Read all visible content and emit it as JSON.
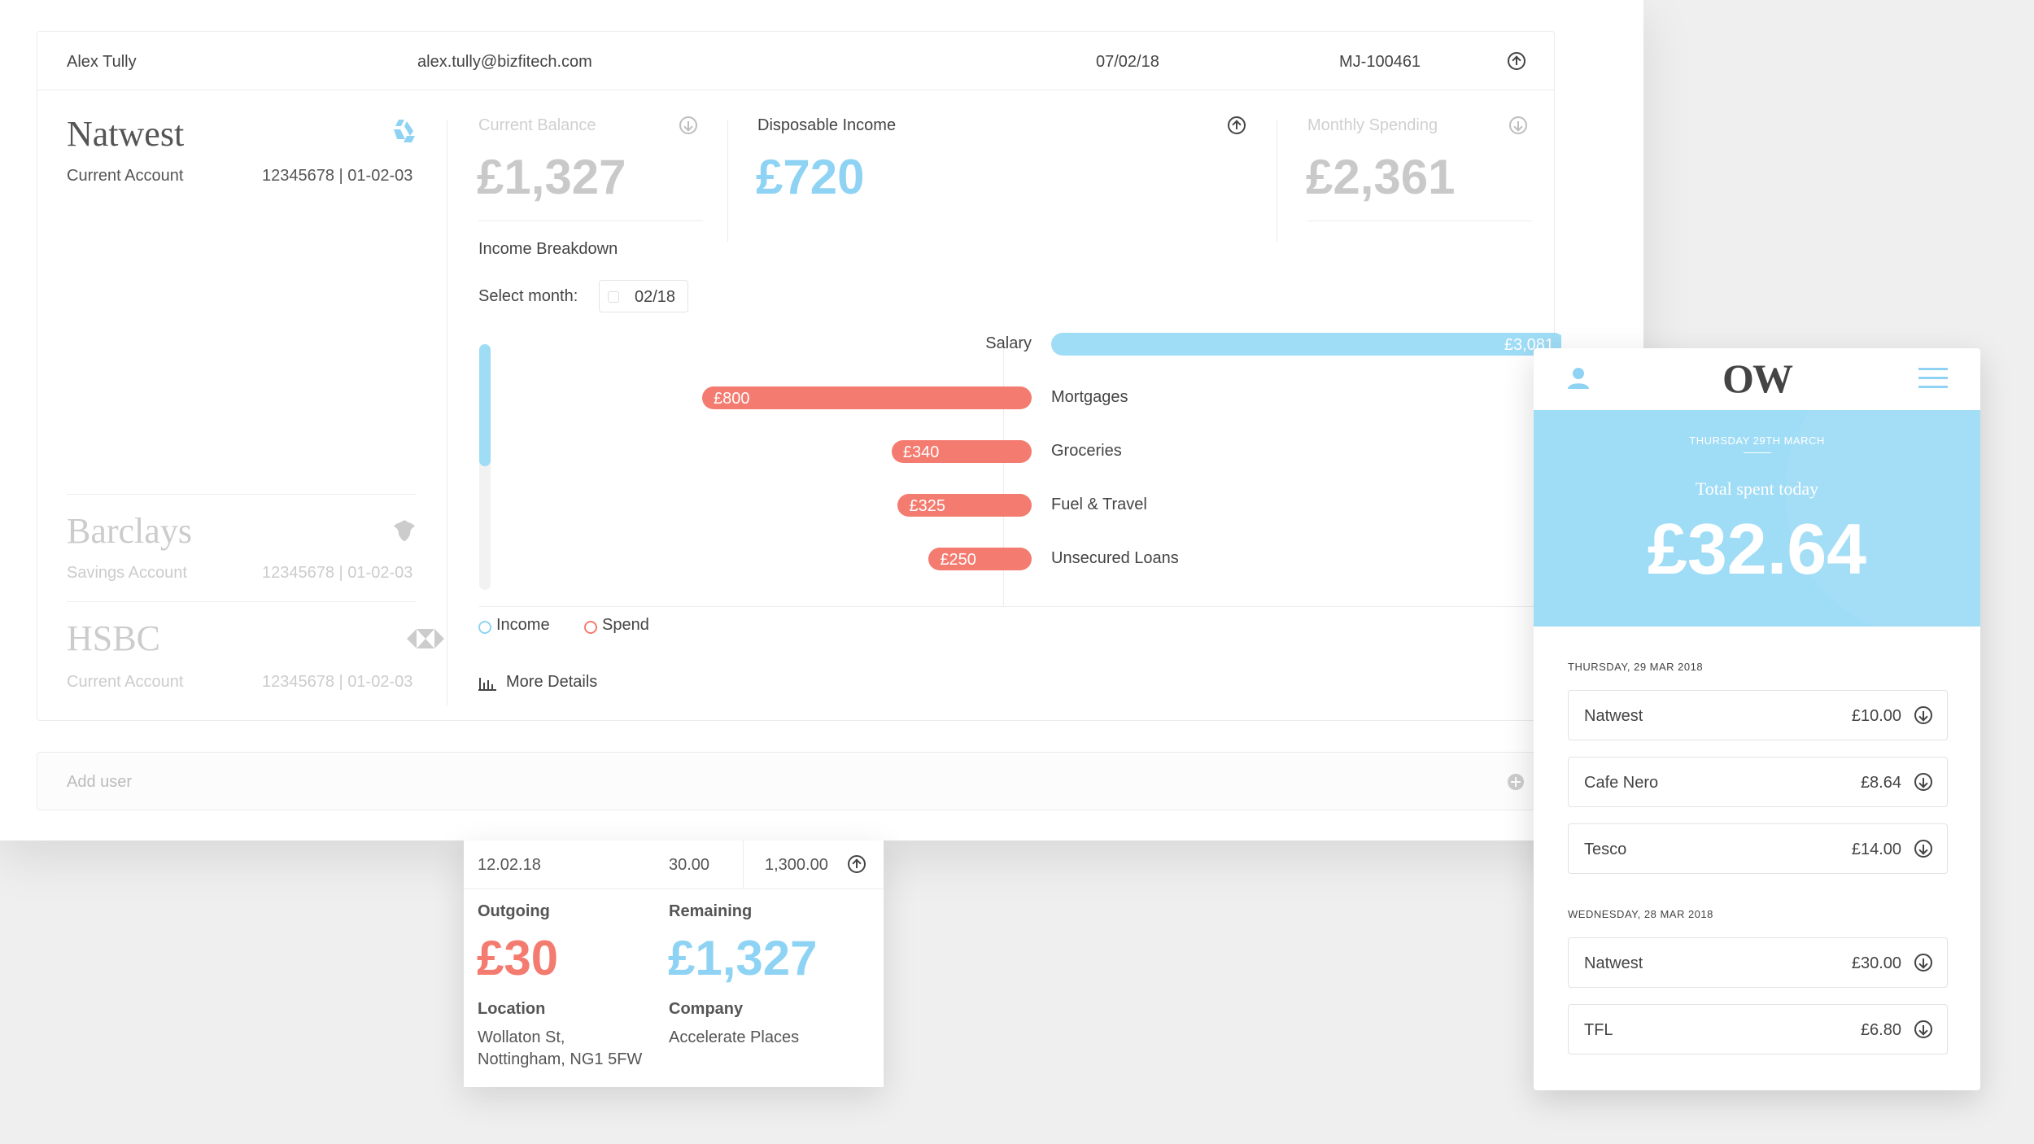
{
  "header": {
    "name": "Alex Tully",
    "email": "alex.tully@bizfitech.com",
    "date": "07/02/18",
    "reference": "MJ-100461"
  },
  "banks": [
    {
      "name": "Natwest",
      "type": "Current Account",
      "account": "12345678 | 01-02-03"
    },
    {
      "name": "Barclays",
      "type": "Savings Account",
      "account": "12345678 | 01-02-03"
    },
    {
      "name": "HSBC",
      "type": "Current Account",
      "account": "12345678 | 01-02-03"
    }
  ],
  "kpis": {
    "current_balance": {
      "label": "Current Balance",
      "value": "£1,327"
    },
    "disposable_income": {
      "label": "Disposable Income",
      "value": "£720"
    },
    "monthly_spending": {
      "label": "Monthly Spending",
      "value": "£2,361"
    }
  },
  "breakdown": {
    "title": "Income Breakdown",
    "select_label": "Select month:",
    "month": "02/18",
    "legend_income": "Income",
    "legend_spend": "Spend",
    "more_details": "More Details"
  },
  "chart_data": {
    "type": "bar",
    "series": [
      {
        "name": "Income",
        "categories": [
          "Salary"
        ],
        "values": [
          3081
        ],
        "labels": [
          "£3,081"
        ]
      },
      {
        "name": "Spend",
        "categories": [
          "Mortgages",
          "Groceries",
          "Fuel & Travel",
          "Unsecured Loans"
        ],
        "values": [
          800,
          340,
          325,
          250
        ],
        "labels": [
          "£800",
          "£340",
          "£325",
          "£250"
        ]
      }
    ]
  },
  "add_user": "Add user",
  "transaction": {
    "date": "12.02.18",
    "amount": "30.00",
    "balance": "1,300.00",
    "outgoing_label": "Outgoing",
    "outgoing_value": "£30",
    "remaining_label": "Remaining",
    "remaining_value": "£1,327",
    "location_label": "Location",
    "location_line1": "Wollaton St,",
    "location_line2": "Nottingham, NG1 5FW",
    "company_label": "Company",
    "company_value": "Accelerate Places"
  },
  "mobile": {
    "logo": "OW",
    "hero_date": "THURSDAY 29TH MARCH",
    "hero_label": "Total spent today",
    "hero_value": "£32.64",
    "groups": [
      {
        "date": "THURSDAY, 29 MAR 2018",
        "items": [
          {
            "name": "Natwest",
            "amount": "£10.00"
          },
          {
            "name": "Cafe Nero",
            "amount": "£8.64"
          },
          {
            "name": "Tesco",
            "amount": "£14.00"
          }
        ]
      },
      {
        "date": "WEDNESDAY, 28 MAR 2018",
        "items": [
          {
            "name": "Natwest",
            "amount": "£30.00"
          },
          {
            "name": "TFL",
            "amount": "£6.80"
          }
        ]
      }
    ]
  },
  "colors": {
    "income": "#9fdcf6",
    "spend": "#f47b6f",
    "accent_blue": "#8fd3f4"
  }
}
